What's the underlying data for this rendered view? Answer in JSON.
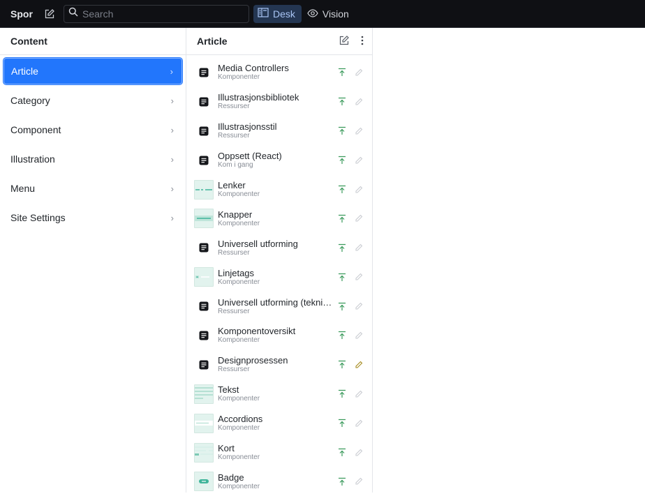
{
  "topbar": {
    "brand": "Spor",
    "search_placeholder": "Search",
    "tools": [
      {
        "label": "Desk",
        "icon": "desk-icon",
        "active": true
      },
      {
        "label": "Vision",
        "icon": "eye-icon",
        "active": false
      }
    ]
  },
  "content_pane": {
    "title": "Content",
    "items": [
      {
        "label": "Article",
        "active": true
      },
      {
        "label": "Category"
      },
      {
        "label": "Component"
      },
      {
        "label": "Illustration"
      },
      {
        "label": "Menu"
      },
      {
        "label": "Site Settings"
      }
    ]
  },
  "article_pane": {
    "title": "Article",
    "items": [
      {
        "title": "Media Controllers",
        "subtitle": "Komponenter",
        "thumb": "document"
      },
      {
        "title": "Illustrasjonsbibliotek",
        "subtitle": "Ressurser",
        "thumb": "document"
      },
      {
        "title": "Illustrasjonsstil",
        "subtitle": "Ressurser",
        "thumb": "document"
      },
      {
        "title": "Oppsett (React)",
        "subtitle": "Kom i gang",
        "thumb": "document"
      },
      {
        "title": "Lenker",
        "subtitle": "Komponenter",
        "thumb": "links"
      },
      {
        "title": "Knapper",
        "subtitle": "Komponenter",
        "thumb": "buttons"
      },
      {
        "title": "Universell utforming",
        "subtitle": "Ressurser",
        "thumb": "document"
      },
      {
        "title": "Linjetags",
        "subtitle": "Komponenter",
        "thumb": "linetags"
      },
      {
        "title": "Universell utforming (teknisk...",
        "subtitle": "Ressurser",
        "thumb": "document"
      },
      {
        "title": "Komponentoversikt",
        "subtitle": "Komponenter",
        "thumb": "document"
      },
      {
        "title": "Designprosessen",
        "subtitle": "Ressurser",
        "thumb": "document",
        "edited": true
      },
      {
        "title": "Tekst",
        "subtitle": "Komponenter",
        "thumb": "text"
      },
      {
        "title": "Accordions",
        "subtitle": "Komponenter",
        "thumb": "accordions"
      },
      {
        "title": "Kort",
        "subtitle": "Komponenter",
        "thumb": "cards"
      },
      {
        "title": "Badge",
        "subtitle": "Komponenter",
        "thumb": "badge"
      }
    ]
  },
  "colors": {
    "accent": "#2276fc",
    "published": "#3a9a5b",
    "draft_edit": "#a58a1c",
    "muted_edit": "#c9ccd1"
  }
}
